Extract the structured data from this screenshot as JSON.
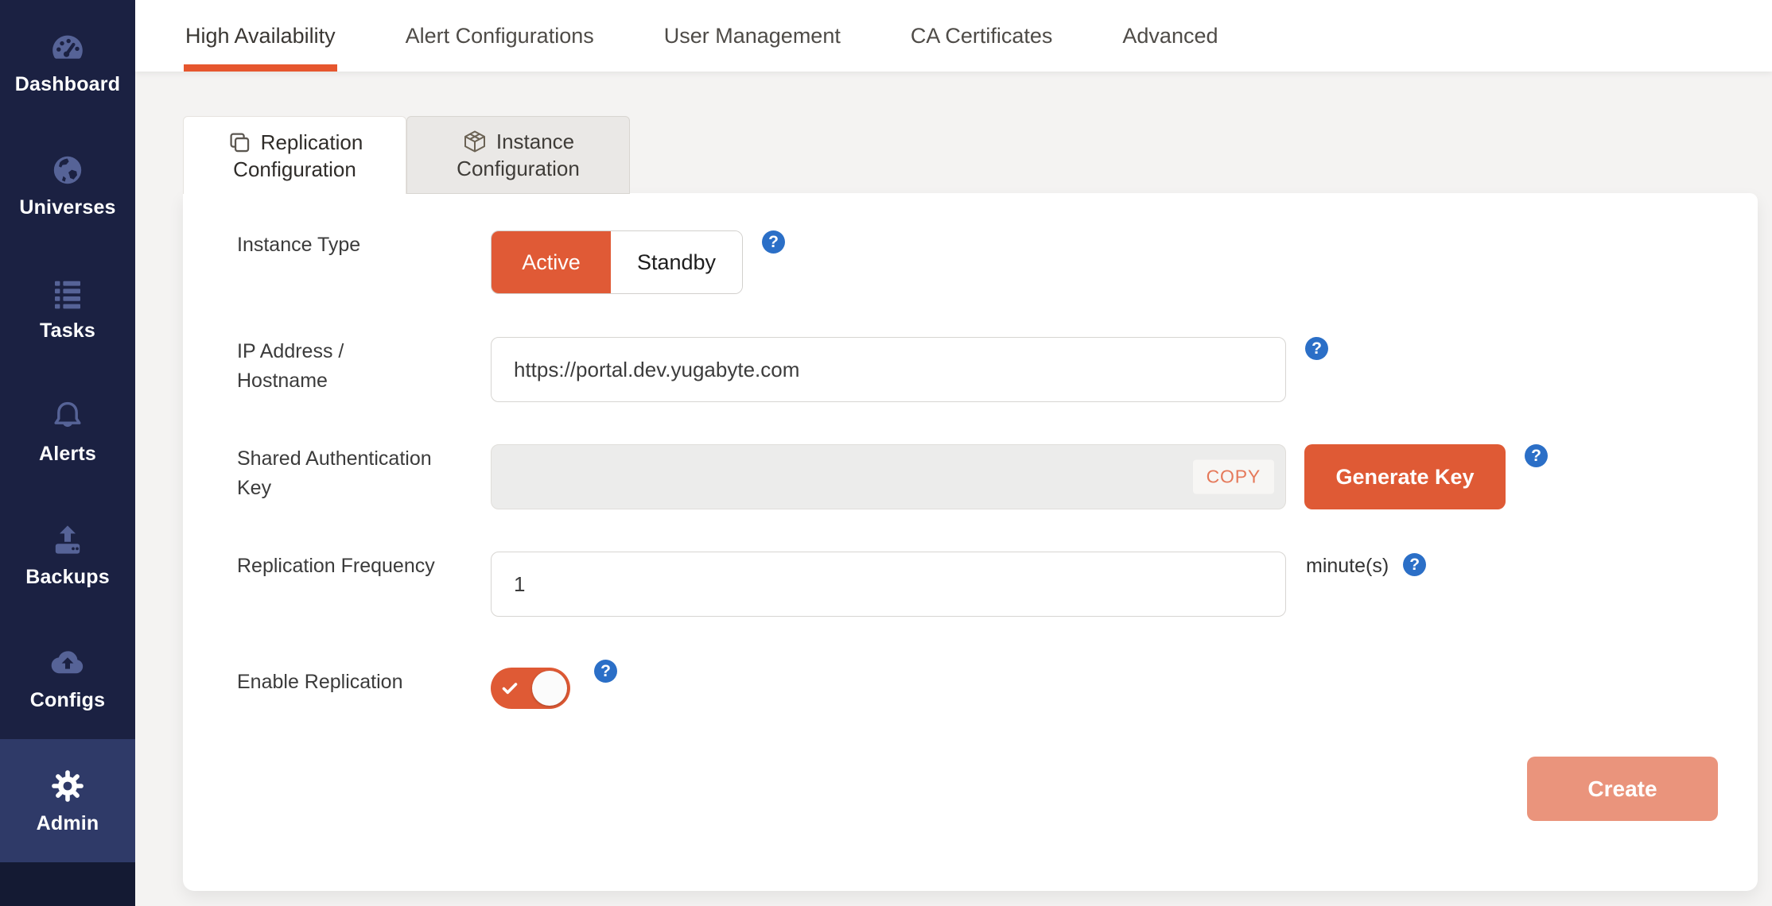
{
  "sidebar": {
    "items": [
      {
        "label": "Dashboard",
        "icon": "dashboard-gauge-icon",
        "active": false
      },
      {
        "label": "Universes",
        "icon": "globe-icon",
        "active": false
      },
      {
        "label": "Tasks",
        "icon": "task-list-icon",
        "active": false
      },
      {
        "label": "Alerts",
        "icon": "bell-icon",
        "active": false
      },
      {
        "label": "Backups",
        "icon": "backup-upload-icon",
        "active": false
      },
      {
        "label": "Configs",
        "icon": "cloud-upload-icon",
        "active": false
      },
      {
        "label": "Admin",
        "icon": "gear-icon",
        "active": true
      }
    ]
  },
  "tabs": [
    {
      "label": "High Availability",
      "active": true
    },
    {
      "label": "Alert Configurations",
      "active": false
    },
    {
      "label": "User Management",
      "active": false
    },
    {
      "label": "CA Certificates",
      "active": false
    },
    {
      "label": "Advanced",
      "active": false
    }
  ],
  "subtabs": [
    {
      "label": "Replication Configuration",
      "icon": "copy-icon",
      "active": true
    },
    {
      "label": "Instance Configuration",
      "icon": "box-icon",
      "active": false
    }
  ],
  "form": {
    "instance_type": {
      "label": "Instance Type",
      "options": [
        "Active",
        "Standby"
      ],
      "selected": "Active"
    },
    "ip_address": {
      "label": "IP Address / Hostname",
      "value": "https://portal.dev.yugabyte.com"
    },
    "shared_key": {
      "label": "Shared Authentication Key",
      "value": "",
      "copy_label": "COPY",
      "generate_label": "Generate Key"
    },
    "replication_frequency": {
      "label": "Replication Frequency",
      "value": "1",
      "suffix": "minute(s)"
    },
    "enable_replication": {
      "label": "Enable Replication",
      "enabled": true
    },
    "submit_label": "Create",
    "help_glyph": "?"
  },
  "colors": {
    "accent_orange": "#e05a36",
    "accent_orange_disabled": "#ea947c",
    "help_blue": "#2b6fc7",
    "sidebar_bg": "#1b2142",
    "sidebar_active_bg": "#2f3a68",
    "page_bg": "#f4f3f2"
  }
}
